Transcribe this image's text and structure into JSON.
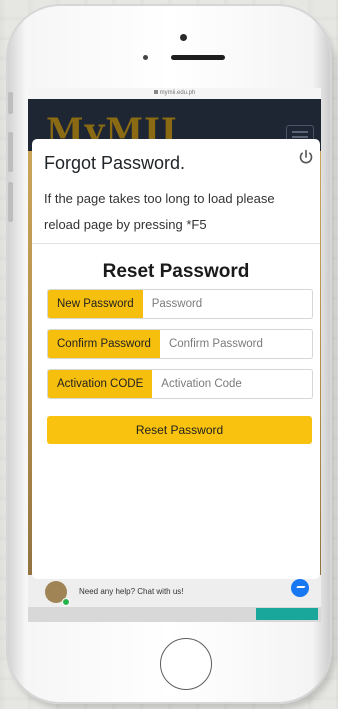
{
  "browser": {
    "url": "mymii.edu.ph"
  },
  "site": {
    "logo": "MyMII",
    "chat": {
      "text": "Need any help? Chat with us!"
    }
  },
  "modal": {
    "title": "Forgot Password.",
    "note": "If the page takes too long to load please reload page by pressing *F5",
    "heading": "Reset Password",
    "fields": [
      {
        "label": "New Password",
        "placeholder": "Password"
      },
      {
        "label": "Confirm Password",
        "placeholder": "Confirm Password"
      },
      {
        "label": "Activation CODE",
        "placeholder": "Activation Code"
      }
    ],
    "submit_label": "Reset Password"
  },
  "colors": {
    "accent": "#f8c20f",
    "header_bg": "#1f2633",
    "messenger": "#1877f2"
  },
  "icons": {
    "power": "power-icon",
    "menu": "hamburger-icon",
    "messenger": "messenger-icon",
    "lock": "lock-icon"
  }
}
